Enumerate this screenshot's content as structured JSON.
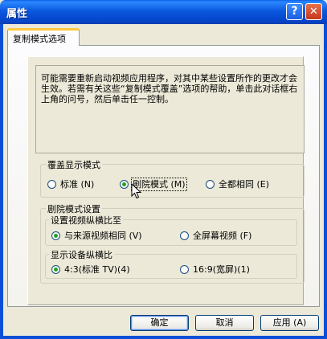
{
  "window": {
    "title": "属性",
    "help_button": "?",
    "close_button": "✕"
  },
  "tab": {
    "label": "复制模式选项"
  },
  "info_text": "可能需要重新启动视频应用程序，对其中某些设置所作的更改才会生效。若需有关这些“复制模式覆盖”选项的帮助，单击此对话框右上角的问号，然后单击任一控制。",
  "overlay_group": {
    "title": "覆盖显示模式",
    "options": [
      {
        "label": "标准 (N)",
        "selected": false
      },
      {
        "label": "剧院模式 (M)",
        "selected": true
      },
      {
        "label": "全都相同 (E)",
        "selected": false
      }
    ]
  },
  "theater_group": {
    "title": "剧院模式设置",
    "video_aspect": {
      "title": "设置视频纵横比至",
      "options": [
        {
          "label": "与来源视频相同 (V)",
          "selected": true
        },
        {
          "label": "全屏幕视频 (F)",
          "selected": false
        }
      ]
    },
    "device_aspect": {
      "title": "显示设备纵横比",
      "options": [
        {
          "label": "4:3(标准 TV)(4)",
          "selected": true
        },
        {
          "label": "16:9(宽屏)(1)",
          "selected": false
        }
      ]
    }
  },
  "buttons": {
    "ok": "确定",
    "cancel": "取消",
    "apply": "应用 (A)"
  }
}
